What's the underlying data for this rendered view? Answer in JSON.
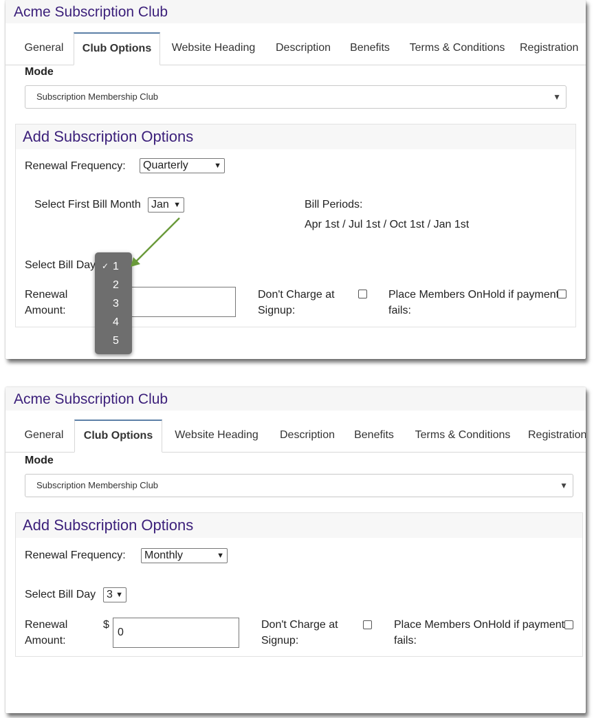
{
  "screens": [
    {
      "app_title": "Acme Subscription Club",
      "tabs": [
        "General",
        "Club Options",
        "Website Heading",
        "Description",
        "Benefits",
        "Terms & Conditions",
        "Registration"
      ],
      "mode_label": "Mode",
      "mode_value": "Subscription Membership Club",
      "section_title": "Add Subscription Options",
      "renewal_frequency_label": "Renewal Frequency:",
      "renewal_frequency_value": "Quarterly",
      "first_bill_month_label": "Select First Bill Month",
      "first_bill_month_value": "Jan",
      "bill_periods_label": "Bill Periods:",
      "bill_periods_value": "Apr 1st / Jul 1st / Oct 1st / Jan 1st",
      "bill_day_label": "Select Bill Day",
      "bill_day_options": [
        "1",
        "2",
        "3",
        "4",
        "5"
      ],
      "bill_day_checkmark": "✓",
      "renewal_amount_label_1": "Renewal",
      "renewal_amount_label_2": "Amount:",
      "dont_charge_label_1": "Don't Charge at",
      "dont_charge_label_2": "Signup:",
      "onhold_label_1": "Place Members OnHold if payment",
      "onhold_label_2": "fails:"
    },
    {
      "app_title": "Acme Subscription Club",
      "tabs": [
        "General",
        "Club Options",
        "Website Heading",
        "Description",
        "Benefits",
        "Terms & Conditions",
        "Registration"
      ],
      "mode_label": "Mode",
      "mode_value": "Subscription Membership Club",
      "section_title": "Add Subscription Options",
      "renewal_frequency_label": "Renewal Frequency:",
      "renewal_frequency_value": "Monthly",
      "bill_day_label": "Select Bill Day",
      "bill_day_value": "3",
      "renewal_amount_label_1": "Renewal",
      "renewal_amount_label_2": "Amount:",
      "currency_symbol": "$",
      "renewal_amount_value": "0",
      "dont_charge_label_1": "Don't Charge at",
      "dont_charge_label_2": "Signup:",
      "onhold_label_1": "Place Members OnHold if payment",
      "onhold_label_2": "fails:"
    }
  ],
  "icons": {
    "select_chevron": "chevron-down-icon",
    "annotation_arrow": "arrow-icon",
    "checkmark": "check-icon"
  },
  "colors": {
    "title": "#3b1f7a",
    "annotation_arrow": "#6a9a3a",
    "dropdown_bg": "#6e6e6e",
    "active_tab_border": "#5b7fa6"
  }
}
